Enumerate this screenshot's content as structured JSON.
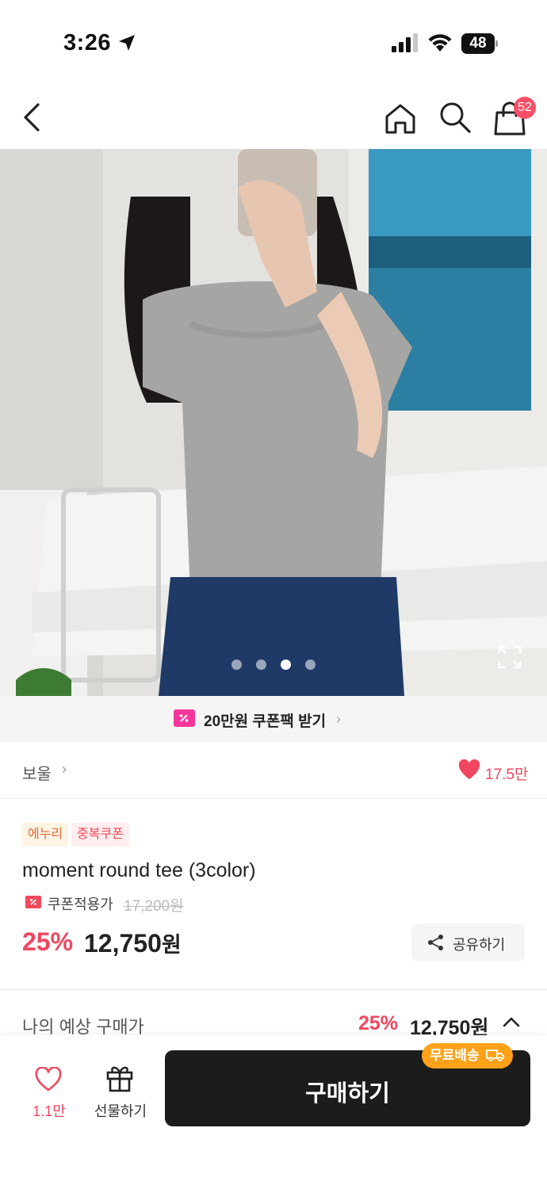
{
  "status_bar": {
    "time": "3:26",
    "battery": "48"
  },
  "header": {
    "cart_count": "52"
  },
  "gallery": {
    "image_count": 4,
    "active_index": 2
  },
  "coupon_banner": {
    "text": "20만원 쿠폰팩 받기",
    "chevron": "›"
  },
  "shop": {
    "name": "보울",
    "chevron": "›",
    "likes": "17.5만"
  },
  "tags": [
    {
      "label": "에누리",
      "color": "#e56a3a"
    },
    {
      "label": "중복쿠폰",
      "color": "#f3475c"
    }
  ],
  "product": {
    "title": "moment round tee (3color)",
    "coupon_label": "쿠폰적용가",
    "original_price": "17,200원",
    "discount_rate": "25%",
    "sale_price": "12,750",
    "currency": "원",
    "share_label": "공유하기"
  },
  "expected": {
    "label": "나의 예상 구매가",
    "rate": "25%",
    "price": "12,750원"
  },
  "bottom_bar": {
    "wish_count": "1.1만",
    "gift_label": "선물하기",
    "buy_label": "구매하기",
    "free_shipping": "무료배송"
  },
  "colors": {
    "accent_red": "#f04760",
    "buy_button": "#1c1c1c",
    "free_ship_badge": "#ffa21a",
    "coupon_pink": "#f8359b"
  }
}
